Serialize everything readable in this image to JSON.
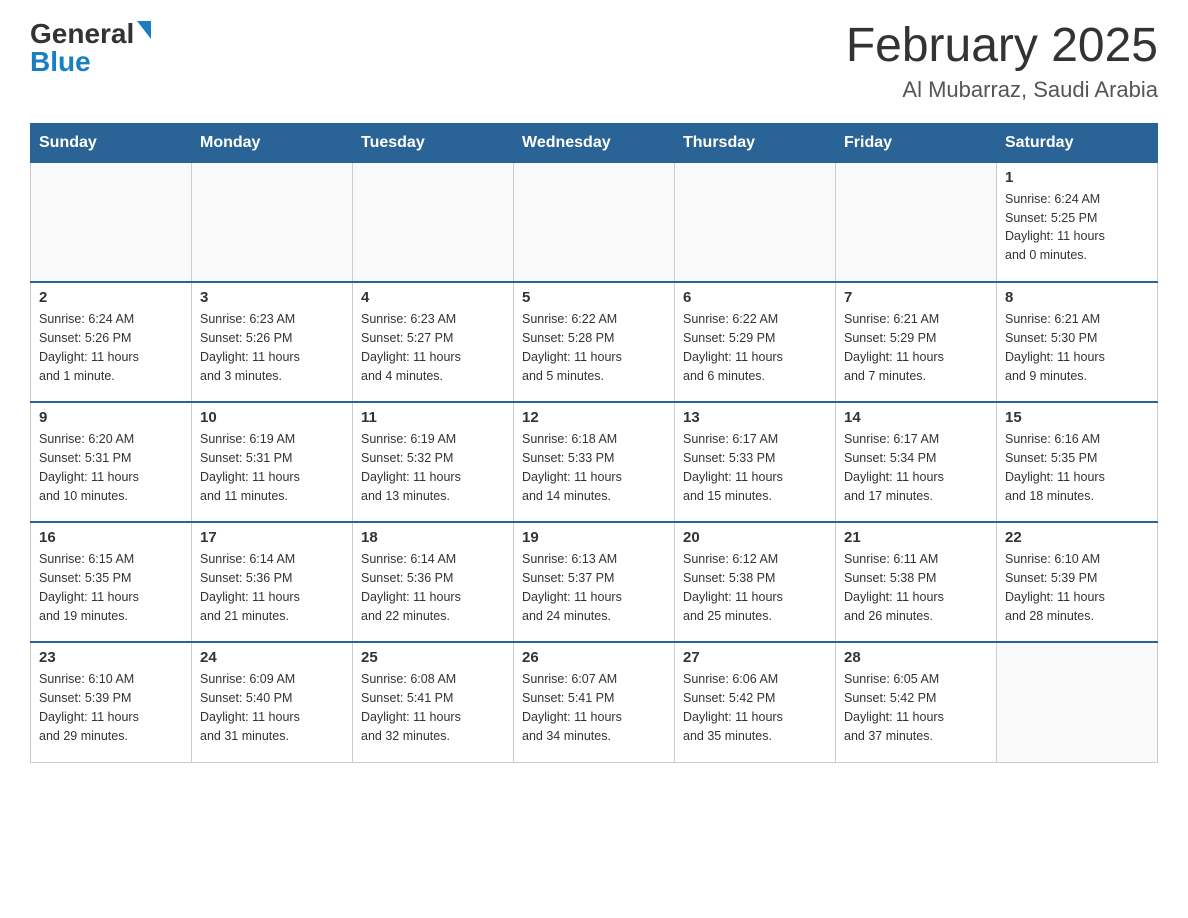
{
  "header": {
    "logo_general": "General",
    "logo_blue": "Blue",
    "month_title": "February 2025",
    "location": "Al Mubarraz, Saudi Arabia"
  },
  "days_of_week": [
    "Sunday",
    "Monday",
    "Tuesday",
    "Wednesday",
    "Thursday",
    "Friday",
    "Saturday"
  ],
  "weeks": [
    {
      "days": [
        {
          "num": "",
          "info": ""
        },
        {
          "num": "",
          "info": ""
        },
        {
          "num": "",
          "info": ""
        },
        {
          "num": "",
          "info": ""
        },
        {
          "num": "",
          "info": ""
        },
        {
          "num": "",
          "info": ""
        },
        {
          "num": "1",
          "info": "Sunrise: 6:24 AM\nSunset: 5:25 PM\nDaylight: 11 hours\nand 0 minutes."
        }
      ]
    },
    {
      "days": [
        {
          "num": "2",
          "info": "Sunrise: 6:24 AM\nSunset: 5:26 PM\nDaylight: 11 hours\nand 1 minute."
        },
        {
          "num": "3",
          "info": "Sunrise: 6:23 AM\nSunset: 5:26 PM\nDaylight: 11 hours\nand 3 minutes."
        },
        {
          "num": "4",
          "info": "Sunrise: 6:23 AM\nSunset: 5:27 PM\nDaylight: 11 hours\nand 4 minutes."
        },
        {
          "num": "5",
          "info": "Sunrise: 6:22 AM\nSunset: 5:28 PM\nDaylight: 11 hours\nand 5 minutes."
        },
        {
          "num": "6",
          "info": "Sunrise: 6:22 AM\nSunset: 5:29 PM\nDaylight: 11 hours\nand 6 minutes."
        },
        {
          "num": "7",
          "info": "Sunrise: 6:21 AM\nSunset: 5:29 PM\nDaylight: 11 hours\nand 7 minutes."
        },
        {
          "num": "8",
          "info": "Sunrise: 6:21 AM\nSunset: 5:30 PM\nDaylight: 11 hours\nand 9 minutes."
        }
      ]
    },
    {
      "days": [
        {
          "num": "9",
          "info": "Sunrise: 6:20 AM\nSunset: 5:31 PM\nDaylight: 11 hours\nand 10 minutes."
        },
        {
          "num": "10",
          "info": "Sunrise: 6:19 AM\nSunset: 5:31 PM\nDaylight: 11 hours\nand 11 minutes."
        },
        {
          "num": "11",
          "info": "Sunrise: 6:19 AM\nSunset: 5:32 PM\nDaylight: 11 hours\nand 13 minutes."
        },
        {
          "num": "12",
          "info": "Sunrise: 6:18 AM\nSunset: 5:33 PM\nDaylight: 11 hours\nand 14 minutes."
        },
        {
          "num": "13",
          "info": "Sunrise: 6:17 AM\nSunset: 5:33 PM\nDaylight: 11 hours\nand 15 minutes."
        },
        {
          "num": "14",
          "info": "Sunrise: 6:17 AM\nSunset: 5:34 PM\nDaylight: 11 hours\nand 17 minutes."
        },
        {
          "num": "15",
          "info": "Sunrise: 6:16 AM\nSunset: 5:35 PM\nDaylight: 11 hours\nand 18 minutes."
        }
      ]
    },
    {
      "days": [
        {
          "num": "16",
          "info": "Sunrise: 6:15 AM\nSunset: 5:35 PM\nDaylight: 11 hours\nand 19 minutes."
        },
        {
          "num": "17",
          "info": "Sunrise: 6:14 AM\nSunset: 5:36 PM\nDaylight: 11 hours\nand 21 minutes."
        },
        {
          "num": "18",
          "info": "Sunrise: 6:14 AM\nSunset: 5:36 PM\nDaylight: 11 hours\nand 22 minutes."
        },
        {
          "num": "19",
          "info": "Sunrise: 6:13 AM\nSunset: 5:37 PM\nDaylight: 11 hours\nand 24 minutes."
        },
        {
          "num": "20",
          "info": "Sunrise: 6:12 AM\nSunset: 5:38 PM\nDaylight: 11 hours\nand 25 minutes."
        },
        {
          "num": "21",
          "info": "Sunrise: 6:11 AM\nSunset: 5:38 PM\nDaylight: 11 hours\nand 26 minutes."
        },
        {
          "num": "22",
          "info": "Sunrise: 6:10 AM\nSunset: 5:39 PM\nDaylight: 11 hours\nand 28 minutes."
        }
      ]
    },
    {
      "days": [
        {
          "num": "23",
          "info": "Sunrise: 6:10 AM\nSunset: 5:39 PM\nDaylight: 11 hours\nand 29 minutes."
        },
        {
          "num": "24",
          "info": "Sunrise: 6:09 AM\nSunset: 5:40 PM\nDaylight: 11 hours\nand 31 minutes."
        },
        {
          "num": "25",
          "info": "Sunrise: 6:08 AM\nSunset: 5:41 PM\nDaylight: 11 hours\nand 32 minutes."
        },
        {
          "num": "26",
          "info": "Sunrise: 6:07 AM\nSunset: 5:41 PM\nDaylight: 11 hours\nand 34 minutes."
        },
        {
          "num": "27",
          "info": "Sunrise: 6:06 AM\nSunset: 5:42 PM\nDaylight: 11 hours\nand 35 minutes."
        },
        {
          "num": "28",
          "info": "Sunrise: 6:05 AM\nSunset: 5:42 PM\nDaylight: 11 hours\nand 37 minutes."
        },
        {
          "num": "",
          "info": ""
        }
      ]
    }
  ]
}
